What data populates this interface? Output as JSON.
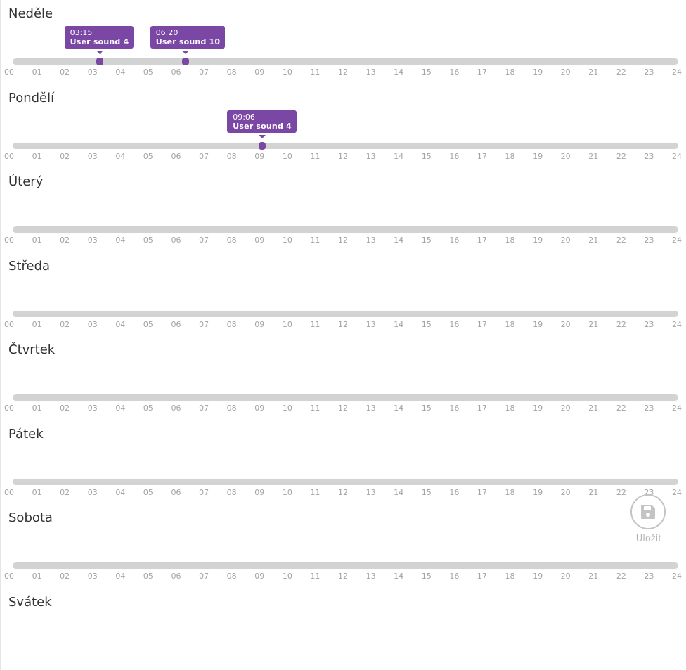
{
  "ticks": [
    "00",
    "01",
    "02",
    "03",
    "04",
    "05",
    "06",
    "07",
    "08",
    "09",
    "10",
    "11",
    "12",
    "13",
    "14",
    "15",
    "16",
    "17",
    "18",
    "19",
    "20",
    "21",
    "22",
    "23",
    "24"
  ],
  "days": [
    {
      "name": "Neděle",
      "alarms": [
        {
          "time": "03:15",
          "sound": "User sound 4"
        },
        {
          "time": "06:20",
          "sound": "User sound 10"
        }
      ]
    },
    {
      "name": "Pondělí",
      "alarms": [
        {
          "time": "09:06",
          "sound": "User sound 4"
        }
      ]
    },
    {
      "name": "Úterý",
      "alarms": []
    },
    {
      "name": "Středa",
      "alarms": []
    },
    {
      "name": "Čtvrtek",
      "alarms": []
    },
    {
      "name": "Pátek",
      "alarms": []
    },
    {
      "name": "Sobota",
      "alarms": []
    },
    {
      "name": "Svátek",
      "alarms": []
    }
  ],
  "save": {
    "label": "Uložit",
    "icon": "floppy-disk-icon"
  },
  "colors": {
    "accent": "#7b47a4",
    "track": "#d3d3d3",
    "tick": "#a3a3a3",
    "text": "#333333",
    "save": "#c4c4c4"
  }
}
